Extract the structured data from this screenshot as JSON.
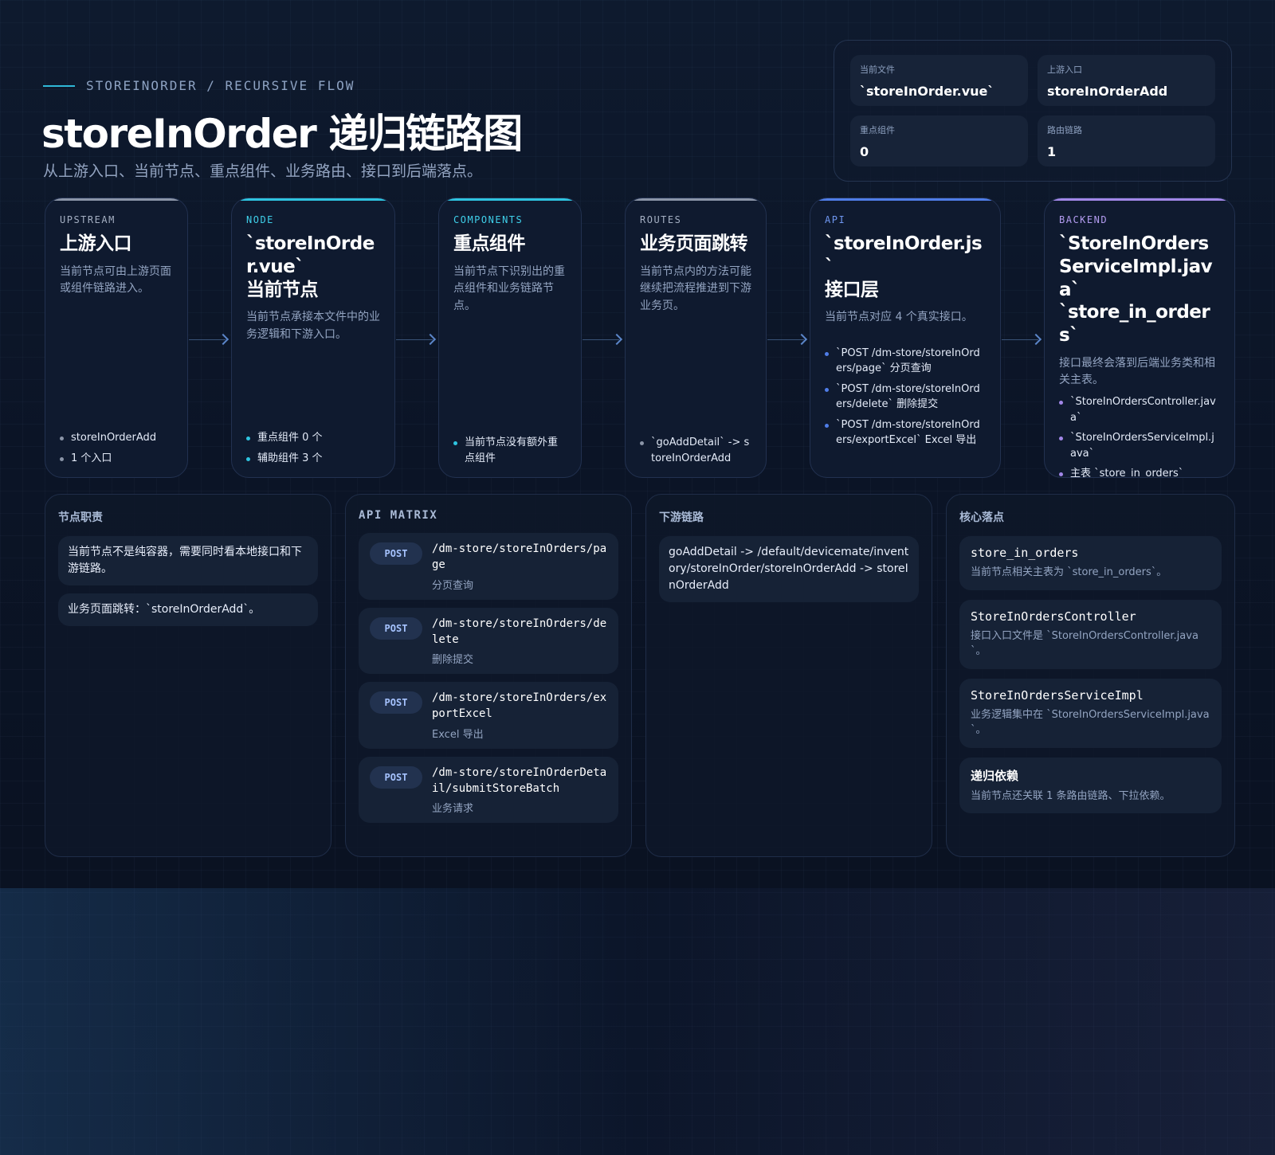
{
  "header": {
    "eyebrow": "STOREINORDER / RECURSIVE FLOW",
    "title": "storeInOrder 递归链路图",
    "subtitle": "从上游入口、当前节点、重点组件、业务路由、接口到后端落点。"
  },
  "summary": [
    {
      "label": "当前文件",
      "value": "`storeInOrder.vue`"
    },
    {
      "label": "上游入口",
      "value": "storeInOrderAdd"
    },
    {
      "label": "重点组件",
      "value": "0"
    },
    {
      "label": "路由链路",
      "value": "1"
    }
  ],
  "colors": {
    "upstream": "#8b95a8",
    "node": "#2ec4e0",
    "components": "#2ec4e0",
    "routes": "#8b95a8",
    "api": "#4f7de8",
    "backend": "#a287e8"
  },
  "flow": {
    "upstream": {
      "tag": "UPSTREAM",
      "title": "上游入口",
      "desc": "当前节点可由上游页面或组件链路进入。",
      "items": [
        "storeInOrderAdd",
        "1 个入口"
      ]
    },
    "node": {
      "tag": "NODE",
      "title1": "`storeInOrder.vue`",
      "title2": "当前节点",
      "desc": "当前节点承接本文件中的业务逻辑和下游入口。",
      "items": [
        "重点组件 0 个",
        "辅助组件 3 个"
      ]
    },
    "components": {
      "tag": "COMPONENTS",
      "title": "重点组件",
      "desc": "当前节点下识别出的重点组件和业务链路节点。",
      "items": [
        "当前节点没有额外重点组件"
      ]
    },
    "routes": {
      "tag": "ROUTES",
      "title": "业务页面跳转",
      "desc": "当前节点内的方法可能继续把流程推进到下游业务页。",
      "items": [
        "`goAddDetail` -> storeInOrderAdd"
      ]
    },
    "api": {
      "tag": "API",
      "title1": "`storeInOrder.js`",
      "title2": "接口层",
      "desc": "当前节点对应 4 个真实接口。",
      "items": [
        "`POST /dm-store/storeInOrders/page` 分页查询",
        "`POST /dm-store/storeInOrders/delete` 删除提交",
        "`POST /dm-store/storeInOrders/exportExcel` Excel 导出"
      ]
    },
    "backend": {
      "tag": "BACKEND",
      "title1": "`StoreInOrdersServiceImpl.java`",
      "title2": "`store_in_orders`",
      "desc": "接口最终会落到后端业务类和相关主表。",
      "items": [
        "`StoreInOrdersController.java`",
        "`StoreInOrdersServiceImpl.java`",
        "主表 `store_in_orders`"
      ]
    }
  },
  "panels": {
    "duties": {
      "title": "节点职责",
      "items": [
        "当前节点不是纯容器，需要同时看本地接口和下游链路。",
        "业务页面跳转：`storeInOrderAdd`。"
      ]
    },
    "api_matrix": {
      "title": "API MATRIX",
      "items": [
        {
          "method": "POST",
          "path": "/dm-store/storeInOrders/page",
          "note": "分页查询"
        },
        {
          "method": "POST",
          "path": "/dm-store/storeInOrders/delete",
          "note": "删除提交"
        },
        {
          "method": "POST",
          "path": "/dm-store/storeInOrders/exportExcel",
          "note": "Excel 导出"
        },
        {
          "method": "POST",
          "path": "/dm-store/storeInOrderDetail/submitStoreBatch",
          "note": "业务请求"
        }
      ]
    },
    "downstream": {
      "title": "下游链路",
      "items": [
        "goAddDetail -> /default/devicemate/inventory/storeInOrder/storeInOrderAdd -> storeInOrderAdd"
      ]
    },
    "core": {
      "title": "核心落点",
      "items": [
        {
          "title": "store_in_orders",
          "desc": "当前节点相关主表为 `store_in_orders`。"
        },
        {
          "title": "StoreInOrdersController",
          "desc": "接口入口文件是 `StoreInOrdersController.java`。"
        },
        {
          "title": "StoreInOrdersServiceImpl",
          "desc": "业务逻辑集中在 `StoreInOrdersServiceImpl.java`。"
        },
        {
          "title": "递归依赖",
          "desc": "当前节点还关联 1 条路由链路、下拉依赖。"
        }
      ]
    }
  }
}
